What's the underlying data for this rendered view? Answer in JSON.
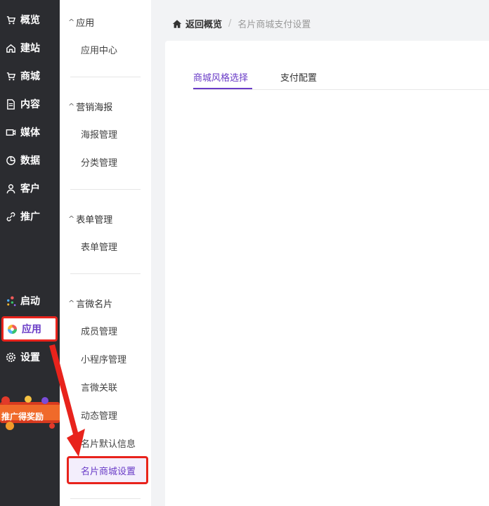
{
  "nav": {
    "items": [
      {
        "label": "概览",
        "icon": "cart-icon"
      },
      {
        "label": "建站",
        "icon": "home-icon"
      },
      {
        "label": "商城",
        "icon": "cart-icon"
      },
      {
        "label": "内容",
        "icon": "document-icon"
      },
      {
        "label": "媒体",
        "icon": "video-icon"
      },
      {
        "label": "数据",
        "icon": "pie-icon"
      },
      {
        "label": "客户",
        "icon": "user-icon"
      },
      {
        "label": "推广",
        "icon": "link-icon"
      },
      {
        "label": "启动",
        "icon": "dots-icon"
      },
      {
        "label": "应用",
        "icon": "app-icon"
      },
      {
        "label": "设置",
        "icon": "gear-icon"
      }
    ],
    "promo_text": "推广得奖励"
  },
  "submenu": {
    "groups": [
      {
        "title": "应用",
        "items": [
          "应用中心"
        ]
      },
      {
        "title": "营销海报",
        "items": [
          "海报管理",
          "分类管理"
        ]
      },
      {
        "title": "表单管理",
        "items": [
          "表单管理"
        ]
      },
      {
        "title": "言微名片",
        "items": [
          "成员管理",
          "小程序管理",
          "言微关联",
          "动态管理",
          "名片默认信息",
          "名片商城设置"
        ]
      }
    ]
  },
  "breadcrumb": {
    "back": "返回概览",
    "separator": "/",
    "current": "名片商城支付设置"
  },
  "tabs": [
    "商城风格选择",
    "支付配置"
  ],
  "colors": {
    "accent": "#6a3cc7",
    "highlight": "#e8231c",
    "nav_bg": "#2b2c30"
  }
}
